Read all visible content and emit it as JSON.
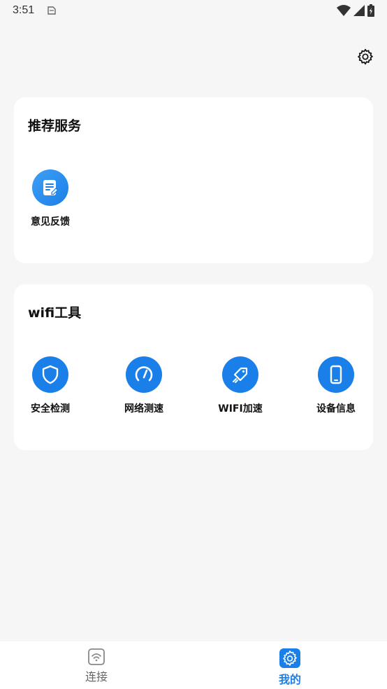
{
  "status_bar": {
    "time": "3:51"
  },
  "recommend": {
    "title": "推荐服务",
    "items": [
      {
        "label": "意见反馈",
        "icon": "feedback-edit-icon"
      }
    ]
  },
  "tools": {
    "title": "wifi工具",
    "items": [
      {
        "label": "安全检测",
        "icon": "shield-icon"
      },
      {
        "label": "网络测速",
        "icon": "speedometer-icon"
      },
      {
        "label": "WIFI加速",
        "icon": "rocket-tag-icon"
      },
      {
        "label": "设备信息",
        "icon": "phone-icon"
      }
    ]
  },
  "bottom_nav": {
    "items": [
      {
        "label": "连接",
        "icon": "wifi-box-icon",
        "active": false
      },
      {
        "label": "我的",
        "icon": "settings-gear-icon",
        "active": true
      }
    ]
  },
  "colors": {
    "accent": "#1a7fe8",
    "background": "#f6f6f6",
    "card": "#ffffff"
  }
}
